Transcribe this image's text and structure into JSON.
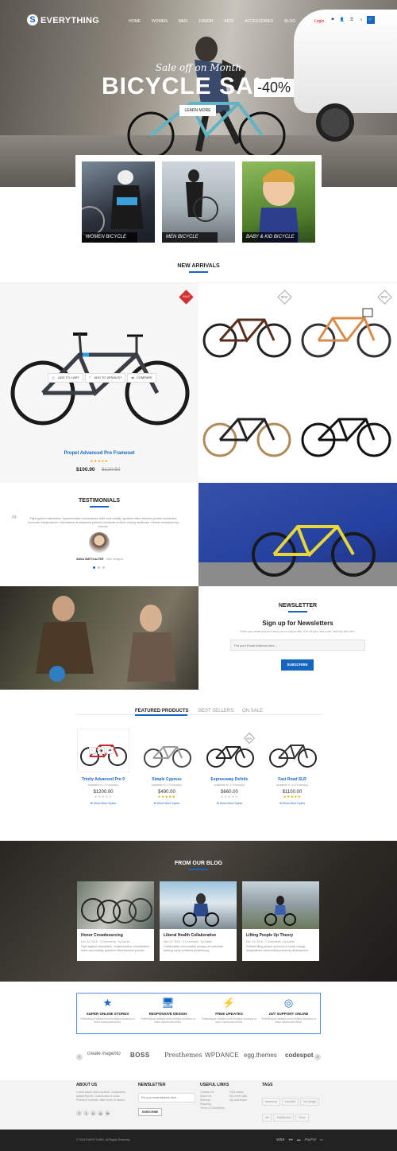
{
  "header": {
    "logo_letter": "S",
    "logo_text": "EVERYTHING",
    "nav": [
      "HOME",
      "WOMEN",
      "MEN",
      "JUNIOR",
      "KIDS",
      "ACCESSORIES",
      "BLOG"
    ],
    "header_link": "Login",
    "icons": [
      "flag-icon",
      "user-icon",
      "lock-icon",
      "search-icon",
      "cart-icon"
    ]
  },
  "hero": {
    "subtitle": "Sale off on Month",
    "title": "BICYCLE SALE",
    "percent": "-40%",
    "button": "LEARN MORE"
  },
  "categories": [
    {
      "label": "WOMEN BICYCLE"
    },
    {
      "label": "MEN BICYCLE"
    },
    {
      "label": "BABY & KID BICYCLE"
    }
  ],
  "new_arrivals": {
    "title": "NEW ARRIVALS",
    "featured": {
      "badge": "SALE",
      "name": "Propel Advanced Pro Frameset",
      "price": "$100.90",
      "old_price": "$120.50",
      "rating": 5,
      "add_to_cart": "ADD TO CART",
      "add_to_wishlist": "ADD TO WISHLIST",
      "compare": "COMPARE"
    },
    "badges": [
      "NEW",
      "NEW"
    ]
  },
  "testimonials": {
    "title": "TESTIMONIALS",
    "quote": "Fight against malnutrition, implementation humanitarian relief rural mobility, grantees effect freedom provide necessities economic independence; international development partners worldwide problem solving healthcare. Honest crowdsourcing reliance.",
    "author": "ANNA SMITH-ALTER",
    "role": "Web designer"
  },
  "newsletter": {
    "title": "NEWSLETTER",
    "heading": "Sign up for Newsletters",
    "text": "Enter your email and we'll send you a coupon with 10% off your next order. Add any text here.",
    "placeholder": "Put your Email Address here...",
    "button": "SUBSCRIBE"
  },
  "products": {
    "tabs": [
      "FEATURED PRODUCTS",
      "BEST SELLERS",
      "ON SALE"
    ],
    "items": [
      {
        "name": "Trinity Advanced Pro 0",
        "availability": "Available in: 2 Product(s)",
        "price": "$1200.00",
        "specs": "Show More Specs"
      },
      {
        "name": "Simple Cypress",
        "availability": "Available in: 2 Product(s)",
        "price": "$490.00",
        "specs": "Show More Specs"
      },
      {
        "name": "Expressway Defstic",
        "availability": "Available in: 2 Product(s)",
        "price": "$660.00",
        "specs": "Show More Specs"
      },
      {
        "name": "Fast Road SLR",
        "availability": "Available in: 11 Product(s)",
        "price": "$1100.00",
        "specs": "Show More Specs"
      }
    ],
    "new_badge": "NEW"
  },
  "blog": {
    "title": "FROM OUR BLOG",
    "posts": [
      {
        "title": "Honor Crowdsourcing",
        "date": "Dec 24, 2015",
        "comments": "0 Comments",
        "author": "by Admin",
        "text": "Fight against malnutrition, implementation humanitarian relief rural mobility, grantees effect freedom provide..."
      },
      {
        "title": "Liberal Health Collaborative",
        "date": "Dec 24, 2015",
        "comments": "0 Comments",
        "author": "by Admin",
        "text": "Collaborative consumption plumpy nut celebrate tackling social problems philanthropy."
      },
      {
        "title": "Lifting People Up Theory",
        "date": "Dec 24, 2015",
        "comments": "1 Comments",
        "author": "by Admin",
        "text": "Political lifting people up theory of social change marginalized communities promising development."
      }
    ]
  },
  "features": [
    {
      "icon": "star-icon",
      "title": "SUPER ONLINE STORES",
      "text": "Pellentesque habitant morbi tristique senectus et netus malesuada fames."
    },
    {
      "icon": "monitor-icon",
      "title": "RESPONSIVE DESIGN",
      "text": "Pellentesque habitant morbi tristique senectus et netus malesuada fames."
    },
    {
      "icon": "bolt-icon",
      "title": "FREE UPDATES",
      "text": "Pellentesque habitant morbi tristique senectus et netus malesuada fames."
    },
    {
      "icon": "lifebuoy-icon",
      "title": "24/7 SUPPORT ONLINE",
      "text": "Pellentesque habitant morbi tristique senectus et netus malesuada fames."
    }
  ],
  "brands": [
    "create magento",
    "BOSS",
    "Presthemes",
    "WPDANCE",
    "egg.themes",
    "codespot"
  ],
  "footer": {
    "about_title": "ABOUT US",
    "about_text": "Lorem ipsum dolor sit amet, consectetur adipiscing elit. Cras at arcu in nunc. Praesent molestie vitae lorem in dictum.",
    "newsletter_title": "NEWSLETTER",
    "newsletter_placeholder": "Put your email address here...",
    "newsletter_button": "SUBSCRIBE",
    "links_title": "USEFUL LINKS",
    "links_left": [
      "Contact Us",
      "About Us",
      "Sitemap",
      "Shipping",
      "Terms & Conditions"
    ],
    "links_right": [
      "FAQ orders",
      "My credit slips",
      "My addresses"
    ],
    "tags_title": "TAGS",
    "tags": [
      "awesome",
      "beautiful",
      "hot design",
      "nis",
      "Skateboard",
      "Shoe",
      "awesome",
      "beautiful",
      "hot design"
    ],
    "copyright": "© 2015 EVERYTHING. All Rights Reserved.",
    "payments": [
      "VISA",
      "PayPal"
    ]
  }
}
